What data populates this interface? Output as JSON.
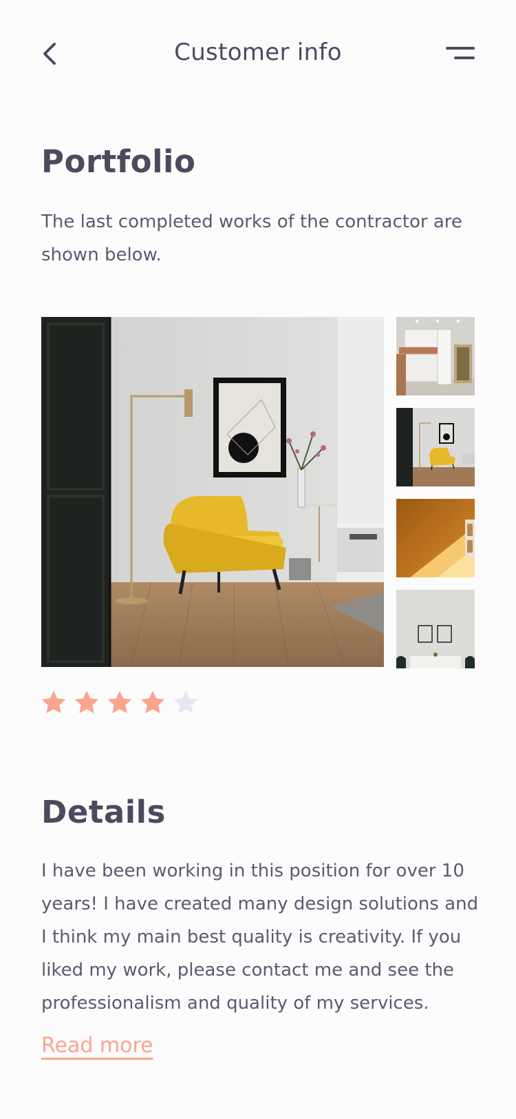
{
  "header": {
    "title": "Customer info",
    "back_icon": "chevron-left-icon",
    "menu_icon": "menu-icon"
  },
  "portfolio": {
    "title": "Portfolio",
    "description": "The last completed works of the contractor are shown below.",
    "images": [
      {
        "name": "living-room-yellow-armchair",
        "role": "main"
      },
      {
        "name": "white-kitchen",
        "role": "thumbnail"
      },
      {
        "name": "living-room-yellow-armchair",
        "role": "thumbnail"
      },
      {
        "name": "orange-wall-with-light",
        "role": "thumbnail"
      },
      {
        "name": "dining-room-frames",
        "role": "thumbnail"
      }
    ],
    "rating": {
      "value": 4,
      "max": 5
    }
  },
  "details": {
    "title": "Details",
    "text": "I have been working in this position for over 10 years! I have created many design solutions and I think my main best quality is creativity. If you liked my work, please contact me and see the professionalism and quality of my services.",
    "read_more": "Read more"
  },
  "colors": {
    "background": "#FDFCFD",
    "text": "#4B4B5F",
    "accent": "#F9A58E",
    "star_empty": "#E8E6F0"
  }
}
